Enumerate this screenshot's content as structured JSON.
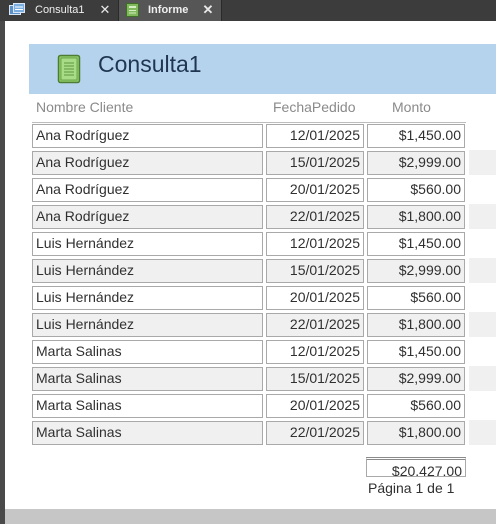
{
  "tabs": [
    {
      "label": "Consulta1",
      "icon": "query-icon",
      "close": "✕"
    },
    {
      "label": "Informe",
      "icon": "report-icon",
      "close": "✕"
    }
  ],
  "report": {
    "title": "Consulta1",
    "icon": "report-book-icon",
    "columns": [
      "Nombre Cliente",
      "FechaPedido",
      "Monto"
    ],
    "rows": [
      {
        "name": "Ana Rodríguez",
        "date": "12/01/2025",
        "amount": "$1,450.00"
      },
      {
        "name": "Ana Rodríguez",
        "date": "15/01/2025",
        "amount": "$2,999.00"
      },
      {
        "name": "Ana Rodríguez",
        "date": "20/01/2025",
        "amount": "$560.00"
      },
      {
        "name": "Ana Rodríguez",
        "date": "22/01/2025",
        "amount": "$1,800.00"
      },
      {
        "name": "Luis Hernández",
        "date": "12/01/2025",
        "amount": "$1,450.00"
      },
      {
        "name": "Luis Hernández",
        "date": "15/01/2025",
        "amount": "$2,999.00"
      },
      {
        "name": "Luis Hernández",
        "date": "20/01/2025",
        "amount": "$560.00"
      },
      {
        "name": "Luis Hernández",
        "date": "22/01/2025",
        "amount": "$1,800.00"
      },
      {
        "name": "Marta Salinas",
        "date": "12/01/2025",
        "amount": "$1,450.00"
      },
      {
        "name": "Marta Salinas",
        "date": "15/01/2025",
        "amount": "$2,999.00"
      },
      {
        "name": "Marta Salinas",
        "date": "20/01/2025",
        "amount": "$560.00"
      },
      {
        "name": "Marta Salinas",
        "date": "22/01/2025",
        "amount": "$1,800.00"
      }
    ],
    "total": "$20,427.00",
    "page_label": "Página 1 de 1"
  },
  "colors": {
    "header_bg": "#b6d3ee",
    "title_color": "#1f3550",
    "alt_row_bg": "#f0f0f0"
  }
}
